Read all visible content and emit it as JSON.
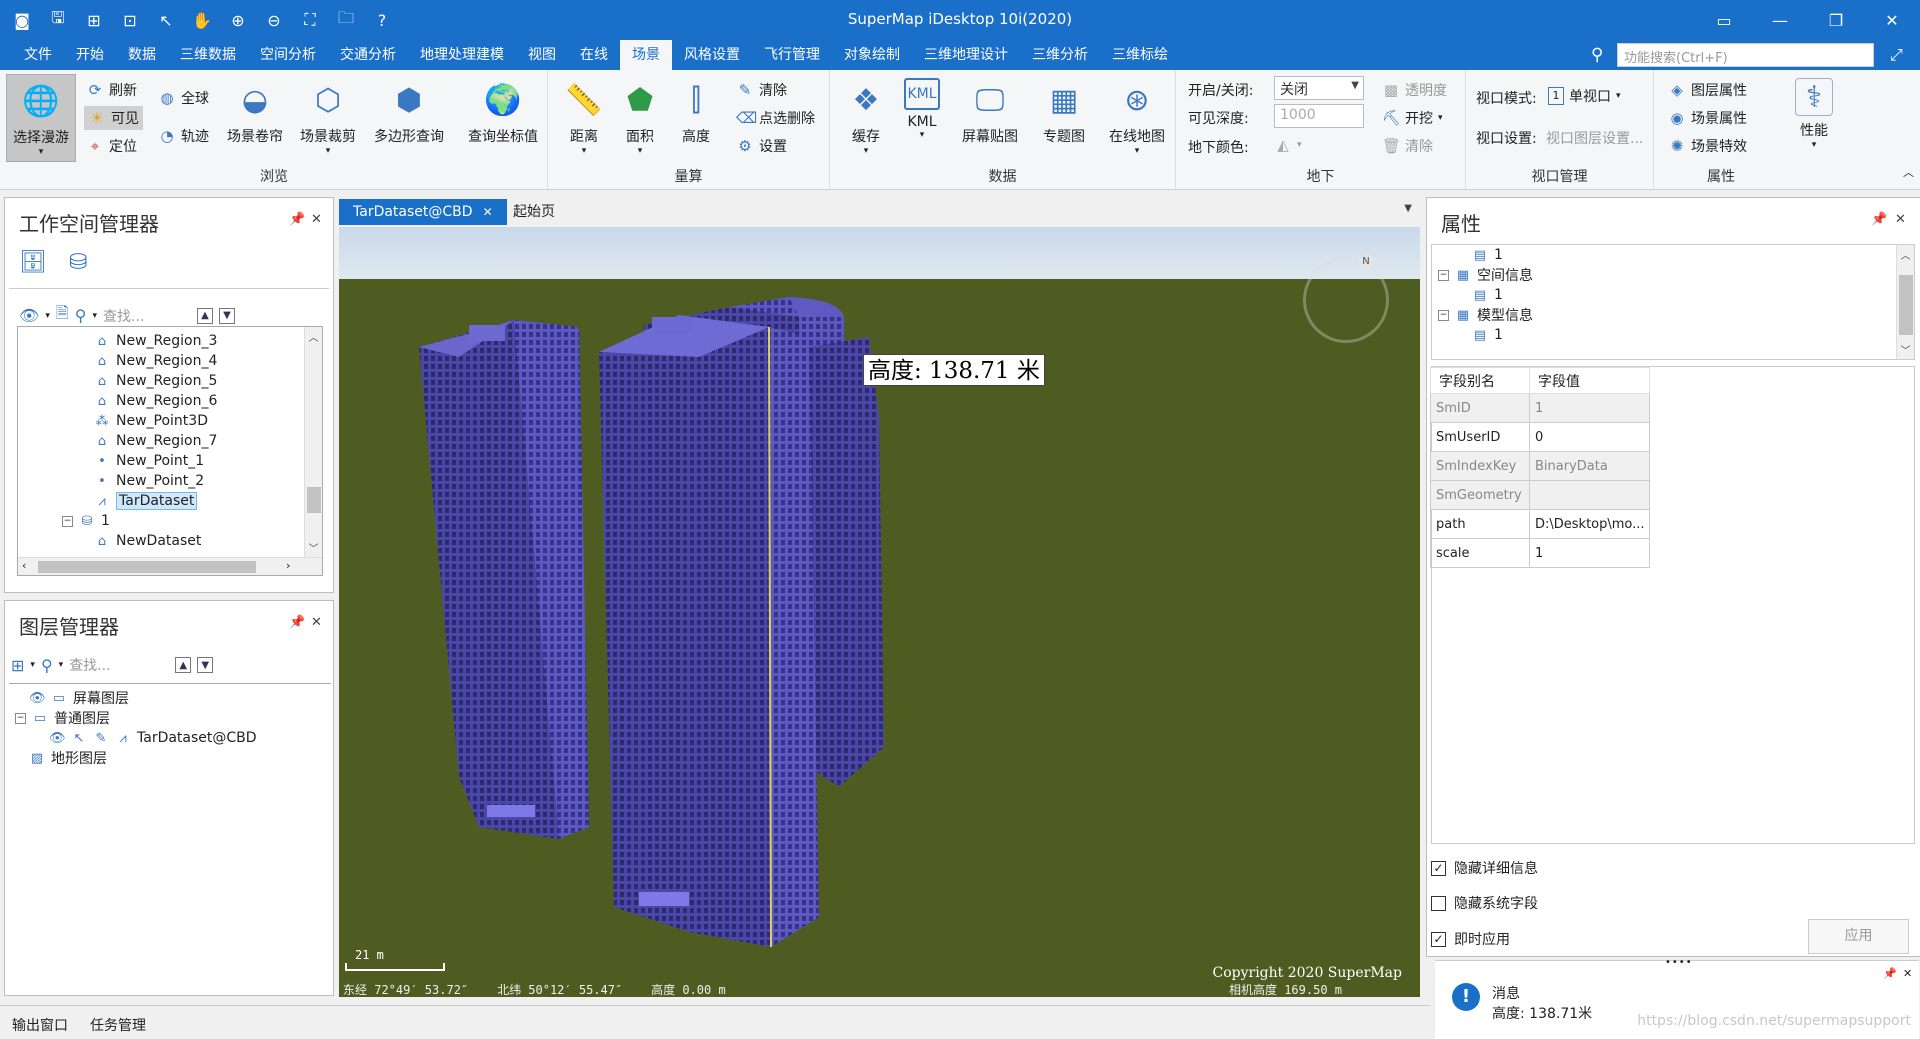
{
  "window": {
    "title": "SuperMap iDesktop 10i(2020)"
  },
  "menu": {
    "tabs": [
      "文件",
      "开始",
      "数据",
      "三维数据",
      "空间分析",
      "交通分析",
      "地理处理建模",
      "视图",
      "在线",
      "场景",
      "风格设置",
      "飞行管理",
      "对象绘制",
      "三维地理设计",
      "三维分析",
      "三维标绘"
    ],
    "active_tab": "场景",
    "search_placeholder": "功能搜索(Ctrl+F)"
  },
  "ribbon": {
    "browse": {
      "label": "浏览",
      "select_roam": "选择漫游",
      "refresh": "刷新",
      "visible": "可见",
      "locate": "定位",
      "globe": "全球",
      "track": "轨迹",
      "scene_roll": "场景卷帘",
      "scene_clip": "场景裁剪",
      "polygon_query": "多边形查询"
    },
    "measure": {
      "label": "量算",
      "query_coord": "查询坐标值",
      "distance": "距离",
      "area": "面积",
      "height": "高度",
      "clear": "清除",
      "select_delete": "点选删除",
      "settings": "设置"
    },
    "data": {
      "label": "数据",
      "cache": "缓存",
      "kml": "KML",
      "screen_paste": "屏幕贴图",
      "thematic": "专题图",
      "online_map": "在线地图"
    },
    "underground": {
      "label": "地下",
      "onoff_label": "开启/关闭:",
      "onoff_value": "关闭",
      "depth_label": "可见深度:",
      "depth_value": "1000",
      "color_label": "地下颜色:",
      "transparency": "透明度",
      "excavate": "开挖",
      "clear": "清除"
    },
    "viewport": {
      "label": "视口管理",
      "mode_label": "视口模式:",
      "mode_value": "单视口",
      "mode_num": "1",
      "settings_label": "视口设置:",
      "settings_value": "视口图层设置..."
    },
    "properties": {
      "label": "属性",
      "layer_props": "图层属性",
      "scene_props": "场景属性",
      "scene_effects": "场景特效",
      "performance": "性能"
    }
  },
  "workspace": {
    "title": "工作空间管理器",
    "find_placeholder": "查找...",
    "items": [
      {
        "label": "New_Region_3",
        "icon": "region-icon"
      },
      {
        "label": "New_Region_4",
        "icon": "region-icon"
      },
      {
        "label": "New_Region_5",
        "icon": "region-icon"
      },
      {
        "label": "New_Region_6",
        "icon": "region-icon"
      },
      {
        "label": "New_Point3D",
        "icon": "point3d-icon"
      },
      {
        "label": "New_Region_7",
        "icon": "region-icon"
      },
      {
        "label": "New_Point_1",
        "icon": "point-icon"
      },
      {
        "label": "New_Point_2",
        "icon": "point-icon"
      },
      {
        "label": "TarDataset",
        "icon": "model-icon"
      },
      {
        "label": "1",
        "icon": "datasource-icon"
      },
      {
        "label": "NewDataset",
        "icon": "region-icon"
      }
    ]
  },
  "layers": {
    "title": "图层管理器",
    "find_placeholder": "查找...",
    "screen_layer": "屏幕图层",
    "normal_layer": "普通图层",
    "model_layer": "TarDataset@CBD",
    "terrain_layer": "地形图层"
  },
  "document": {
    "tabs": [
      "TarDataset@CBD",
      "起始页"
    ],
    "active_tab": "TarDataset@CBD"
  },
  "scene": {
    "measure_label": "高度: 138.71 米",
    "scale": "21 m",
    "copyright": "Copyright 2020 SuperMap",
    "longitude": "东经 72°49′ 53.72″",
    "latitude": "北纬 50°12′ 55.47″",
    "altitude": "高度 0.00 m",
    "camera_height": "相机高度 169.50 m"
  },
  "properties": {
    "title": "属性",
    "tree": [
      {
        "label": "1",
        "level": 2
      },
      {
        "label": "空间信息",
        "level": 1
      },
      {
        "label": "1",
        "level": 2
      },
      {
        "label": "模型信息",
        "level": 1
      },
      {
        "label": "1",
        "level": 2
      }
    ],
    "headers": {
      "alias": "字段别名",
      "value": "字段值"
    },
    "rows": [
      {
        "field": "SmID",
        "value": "1",
        "system": true
      },
      {
        "field": "SmUserID",
        "value": "0",
        "system": false
      },
      {
        "field": "SmIndexKey",
        "value": "BinaryData",
        "system": true
      },
      {
        "field": "SmGeometry",
        "value": "",
        "system": true
      },
      {
        "field": "path",
        "value": "D:\\Desktop\\mo...",
        "system": false
      },
      {
        "field": "scale",
        "value": "1",
        "system": false
      }
    ],
    "hide_detail": "隐藏详细信息",
    "hide_system": "隐藏系统字段",
    "instant_apply": "即时应用",
    "apply": "应用"
  },
  "message": {
    "title": "消息",
    "text": "高度: 138.71米",
    "watermark": "https://blog.csdn.net/supermapsupport"
  },
  "bottom": {
    "output": "输出窗口",
    "tasks": "任务管理"
  }
}
